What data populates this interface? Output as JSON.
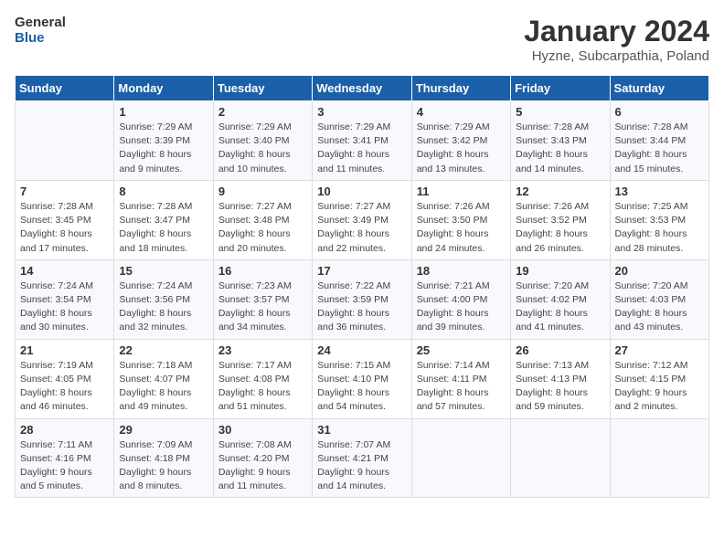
{
  "logo": {
    "line1": "General",
    "line2": "Blue"
  },
  "title": "January 2024",
  "subtitle": "Hyzne, Subcarpathia, Poland",
  "days_header": [
    "Sunday",
    "Monday",
    "Tuesday",
    "Wednesday",
    "Thursday",
    "Friday",
    "Saturday"
  ],
  "weeks": [
    [
      {
        "day": "",
        "content": ""
      },
      {
        "day": "1",
        "content": "Sunrise: 7:29 AM\nSunset: 3:39 PM\nDaylight: 8 hours\nand 9 minutes."
      },
      {
        "day": "2",
        "content": "Sunrise: 7:29 AM\nSunset: 3:40 PM\nDaylight: 8 hours\nand 10 minutes."
      },
      {
        "day": "3",
        "content": "Sunrise: 7:29 AM\nSunset: 3:41 PM\nDaylight: 8 hours\nand 11 minutes."
      },
      {
        "day": "4",
        "content": "Sunrise: 7:29 AM\nSunset: 3:42 PM\nDaylight: 8 hours\nand 13 minutes."
      },
      {
        "day": "5",
        "content": "Sunrise: 7:28 AM\nSunset: 3:43 PM\nDaylight: 8 hours\nand 14 minutes."
      },
      {
        "day": "6",
        "content": "Sunrise: 7:28 AM\nSunset: 3:44 PM\nDaylight: 8 hours\nand 15 minutes."
      }
    ],
    [
      {
        "day": "7",
        "content": "Sunrise: 7:28 AM\nSunset: 3:45 PM\nDaylight: 8 hours\nand 17 minutes."
      },
      {
        "day": "8",
        "content": "Sunrise: 7:28 AM\nSunset: 3:47 PM\nDaylight: 8 hours\nand 18 minutes."
      },
      {
        "day": "9",
        "content": "Sunrise: 7:27 AM\nSunset: 3:48 PM\nDaylight: 8 hours\nand 20 minutes."
      },
      {
        "day": "10",
        "content": "Sunrise: 7:27 AM\nSunset: 3:49 PM\nDaylight: 8 hours\nand 22 minutes."
      },
      {
        "day": "11",
        "content": "Sunrise: 7:26 AM\nSunset: 3:50 PM\nDaylight: 8 hours\nand 24 minutes."
      },
      {
        "day": "12",
        "content": "Sunrise: 7:26 AM\nSunset: 3:52 PM\nDaylight: 8 hours\nand 26 minutes."
      },
      {
        "day": "13",
        "content": "Sunrise: 7:25 AM\nSunset: 3:53 PM\nDaylight: 8 hours\nand 28 minutes."
      }
    ],
    [
      {
        "day": "14",
        "content": "Sunrise: 7:24 AM\nSunset: 3:54 PM\nDaylight: 8 hours\nand 30 minutes."
      },
      {
        "day": "15",
        "content": "Sunrise: 7:24 AM\nSunset: 3:56 PM\nDaylight: 8 hours\nand 32 minutes."
      },
      {
        "day": "16",
        "content": "Sunrise: 7:23 AM\nSunset: 3:57 PM\nDaylight: 8 hours\nand 34 minutes."
      },
      {
        "day": "17",
        "content": "Sunrise: 7:22 AM\nSunset: 3:59 PM\nDaylight: 8 hours\nand 36 minutes."
      },
      {
        "day": "18",
        "content": "Sunrise: 7:21 AM\nSunset: 4:00 PM\nDaylight: 8 hours\nand 39 minutes."
      },
      {
        "day": "19",
        "content": "Sunrise: 7:20 AM\nSunset: 4:02 PM\nDaylight: 8 hours\nand 41 minutes."
      },
      {
        "day": "20",
        "content": "Sunrise: 7:20 AM\nSunset: 4:03 PM\nDaylight: 8 hours\nand 43 minutes."
      }
    ],
    [
      {
        "day": "21",
        "content": "Sunrise: 7:19 AM\nSunset: 4:05 PM\nDaylight: 8 hours\nand 46 minutes."
      },
      {
        "day": "22",
        "content": "Sunrise: 7:18 AM\nSunset: 4:07 PM\nDaylight: 8 hours\nand 49 minutes."
      },
      {
        "day": "23",
        "content": "Sunrise: 7:17 AM\nSunset: 4:08 PM\nDaylight: 8 hours\nand 51 minutes."
      },
      {
        "day": "24",
        "content": "Sunrise: 7:15 AM\nSunset: 4:10 PM\nDaylight: 8 hours\nand 54 minutes."
      },
      {
        "day": "25",
        "content": "Sunrise: 7:14 AM\nSunset: 4:11 PM\nDaylight: 8 hours\nand 57 minutes."
      },
      {
        "day": "26",
        "content": "Sunrise: 7:13 AM\nSunset: 4:13 PM\nDaylight: 8 hours\nand 59 minutes."
      },
      {
        "day": "27",
        "content": "Sunrise: 7:12 AM\nSunset: 4:15 PM\nDaylight: 9 hours\nand 2 minutes."
      }
    ],
    [
      {
        "day": "28",
        "content": "Sunrise: 7:11 AM\nSunset: 4:16 PM\nDaylight: 9 hours\nand 5 minutes."
      },
      {
        "day": "29",
        "content": "Sunrise: 7:09 AM\nSunset: 4:18 PM\nDaylight: 9 hours\nand 8 minutes."
      },
      {
        "day": "30",
        "content": "Sunrise: 7:08 AM\nSunset: 4:20 PM\nDaylight: 9 hours\nand 11 minutes."
      },
      {
        "day": "31",
        "content": "Sunrise: 7:07 AM\nSunset: 4:21 PM\nDaylight: 9 hours\nand 14 minutes."
      },
      {
        "day": "",
        "content": ""
      },
      {
        "day": "",
        "content": ""
      },
      {
        "day": "",
        "content": ""
      }
    ]
  ]
}
